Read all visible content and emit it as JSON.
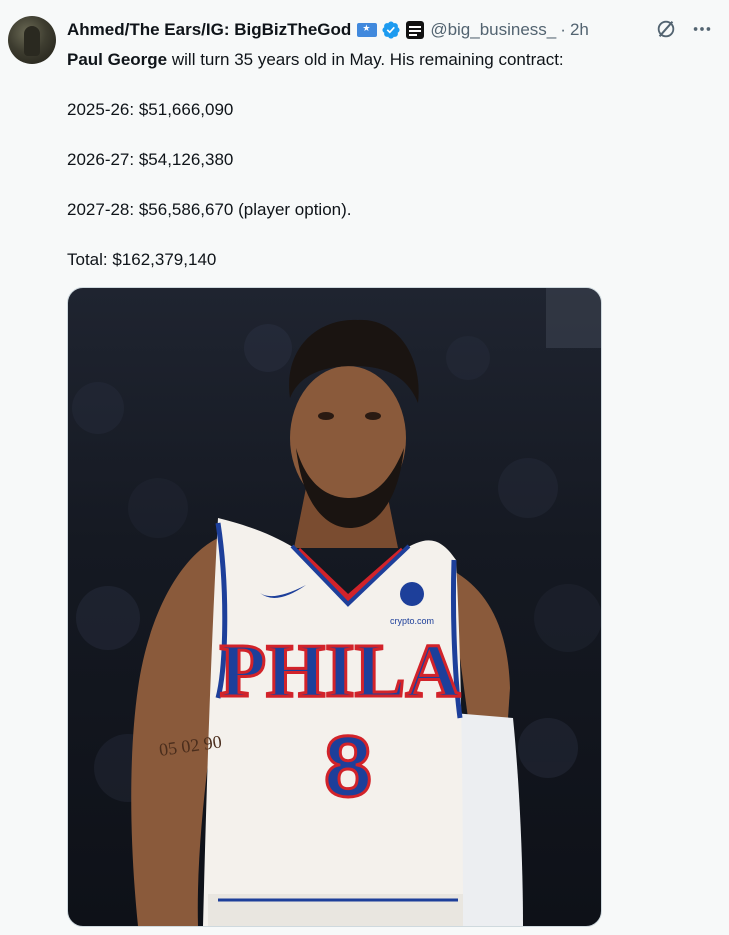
{
  "tweet": {
    "author": {
      "name": "Ahmed/The Ears/IG: BigBizTheGod",
      "handle": "@big_business_",
      "separator": "·",
      "time": "2h"
    },
    "text": {
      "intro_name": "Paul George",
      "intro_rest": " will turn 35 years old in May. His remaining contract:",
      "line1": "2025-26: $51,666,090",
      "line2": "2026-27: $54,126,380",
      "line3": "2027-28: $56,586,670 (player option).",
      "line4": "Total: $162,379,140"
    },
    "media": {
      "jersey_text": "PHILA",
      "jersey_number": "8",
      "sponsor": "crypto.com",
      "tattoo_text": "05 02 90"
    },
    "icons": [
      "avatar",
      "flag-icon",
      "verified-badge-icon",
      "affiliate-badge-icon",
      "grok-icon",
      "more-icon"
    ]
  },
  "colors": {
    "background": "#f7f9f9",
    "text": "#0f1419",
    "secondary": "#536471",
    "verified": "#1d9bf0",
    "jersey_blue": "#1d3f9a",
    "jersey_red": "#d2232a"
  }
}
